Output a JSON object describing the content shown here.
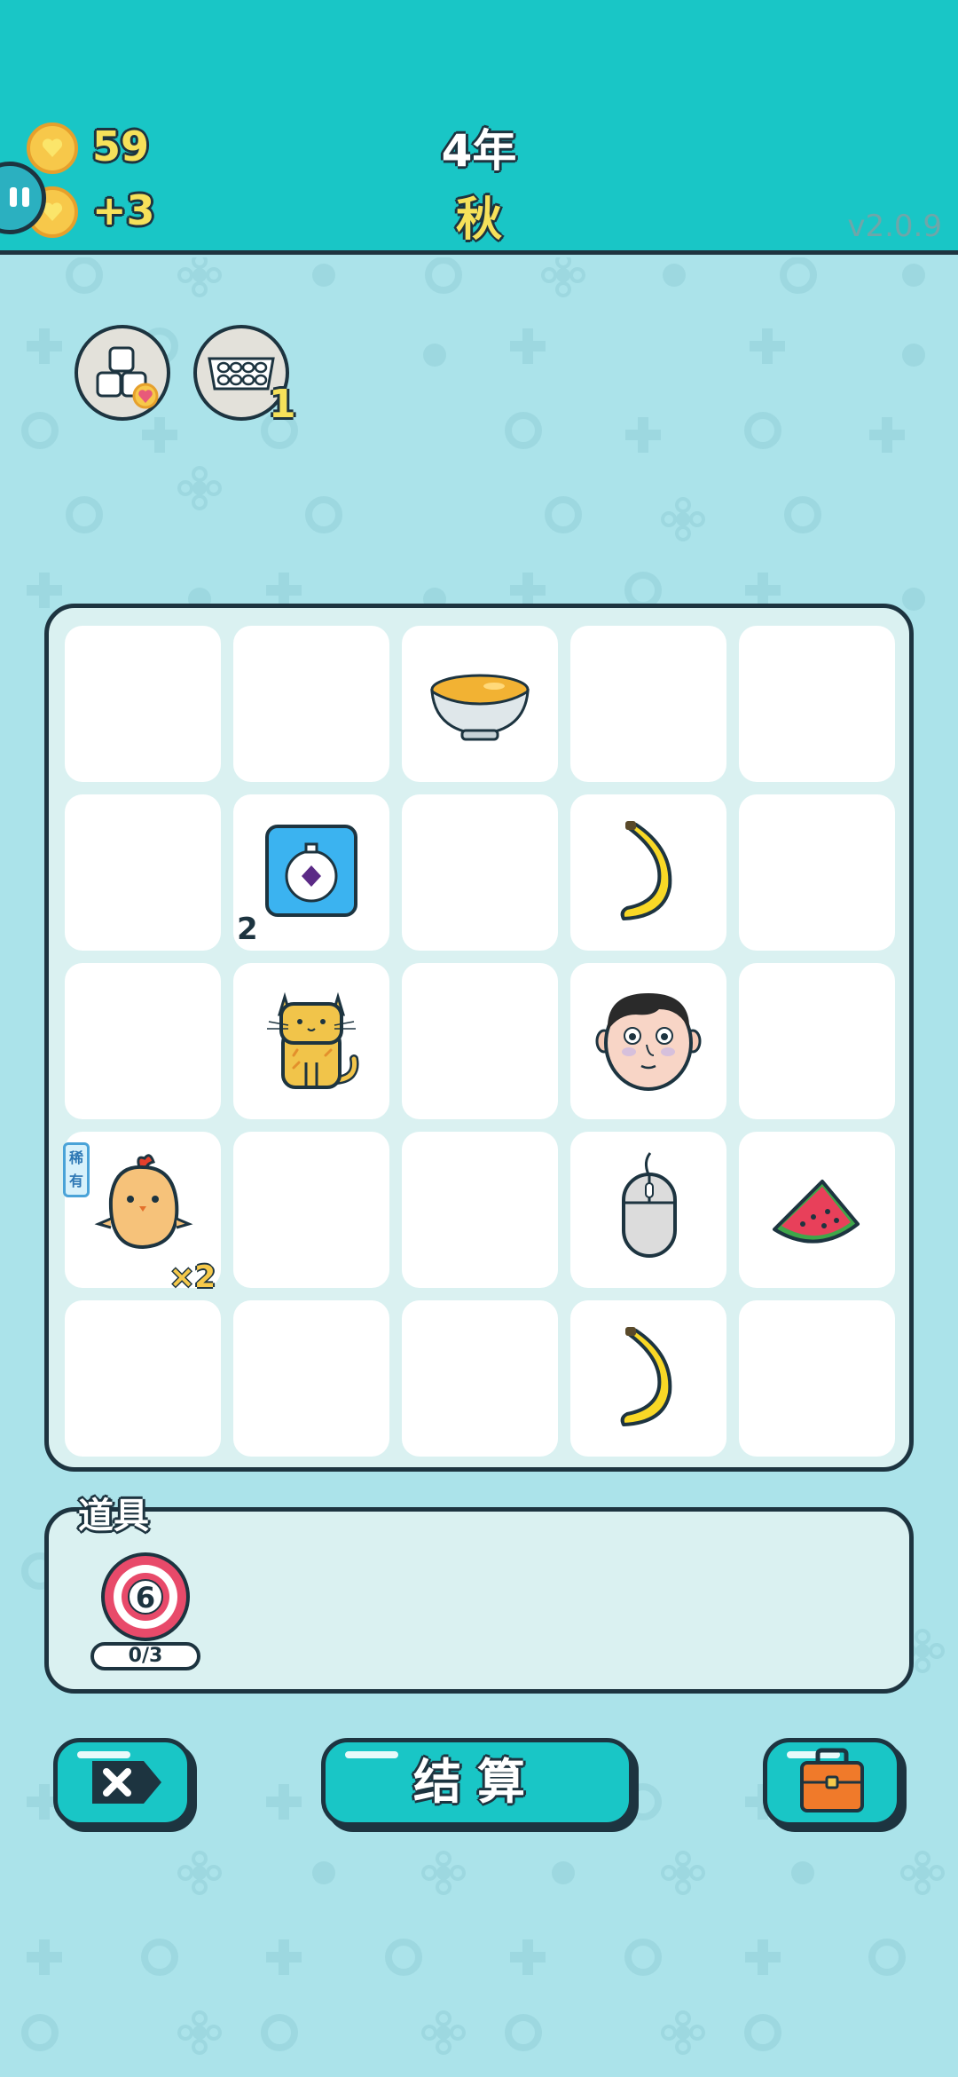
{
  "header": {
    "coins": "59",
    "coins_per_turn": "+3",
    "year": "4年",
    "season": "秋",
    "version": "v2.0.9"
  },
  "relics": [
    {
      "name": "sugar-cubes-icon"
    },
    {
      "name": "egg-tray-icon",
      "count": "1"
    }
  ],
  "board": {
    "rows": [
      [
        "",
        "",
        "soup-bowl",
        "",
        ""
      ],
      [
        "",
        "stopwatch-card",
        "",
        "banana",
        ""
      ],
      [
        "",
        "cat",
        "",
        "face",
        ""
      ],
      [
        "chick",
        "",
        "",
        "mouse",
        "watermelon"
      ],
      [
        "",
        "",
        "",
        "banana",
        ""
      ]
    ],
    "stopwatch_count": "2",
    "chick_rare_tag": "稀有",
    "chick_multiplier": "×2"
  },
  "items": {
    "label": "道具",
    "target_number": "6",
    "target_uses": "0/3"
  },
  "buttons": {
    "settle_label": "结算",
    "remove_icon": "remove-icon",
    "bag_icon": "briefcase-icon"
  },
  "colors": {
    "header": "#19c6c6",
    "background": "#abe3ea",
    "outline": "#1d3440",
    "gold_text": "#f6e15a"
  }
}
